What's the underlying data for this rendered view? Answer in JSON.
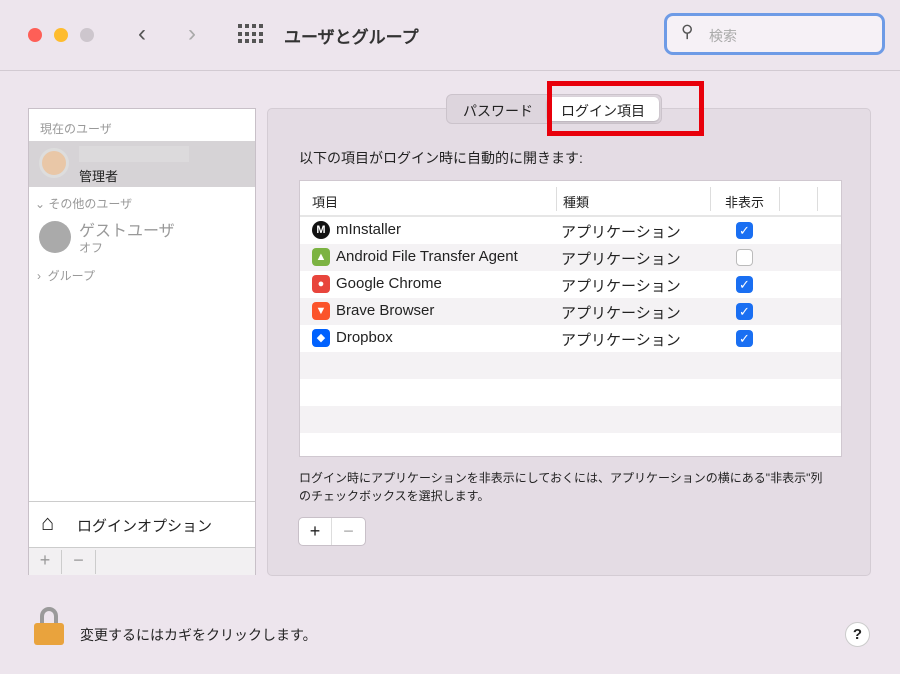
{
  "window": {
    "title": "ユーザとグループ",
    "search_placeholder": "検索"
  },
  "sidebar": {
    "current_section": "現在のユーザ",
    "current_user": {
      "role": "管理者"
    },
    "other_section": "その他のユーザ",
    "guest": {
      "name": "ゲストユーザ",
      "status": "オフ"
    },
    "groups": "グループ",
    "login_options": "ログインオプション",
    "add": "+",
    "remove": "−"
  },
  "tabs": [
    {
      "label": "パスワード"
    },
    {
      "label": "ログイン項目",
      "selected": true
    }
  ],
  "main": {
    "heading": "以下の項目がログイン時に自動的に開きます:",
    "columns": [
      "項目",
      "種類",
      "非表示"
    ],
    "rows": [
      {
        "name": "mInstaller",
        "kind": "アプリケーション",
        "hidden": true,
        "icon": "minstaller-icon"
      },
      {
        "name": "Android File Transfer Agent",
        "kind": "アプリケーション",
        "hidden": false,
        "icon": "android-icon"
      },
      {
        "name": "Google Chrome",
        "kind": "アプリケーション",
        "hidden": true,
        "icon": "chrome-icon"
      },
      {
        "name": "Brave Browser",
        "kind": "アプリケーション",
        "hidden": true,
        "icon": "brave-icon"
      },
      {
        "name": "Dropbox",
        "kind": "アプリケーション",
        "hidden": true,
        "icon": "dropbox-icon"
      }
    ],
    "note": "ログイン時にアプリケーションを非表示にしておくには、アプリケーションの横にある\"非表示\"列のチェックボックスを選択します。",
    "add": "+",
    "remove": "−"
  },
  "footer": {
    "lock_text": "変更するにはカギをクリックします。",
    "help": "?"
  },
  "colors": {
    "accent": "#1a6ff2",
    "highlight": "#e8000b"
  }
}
